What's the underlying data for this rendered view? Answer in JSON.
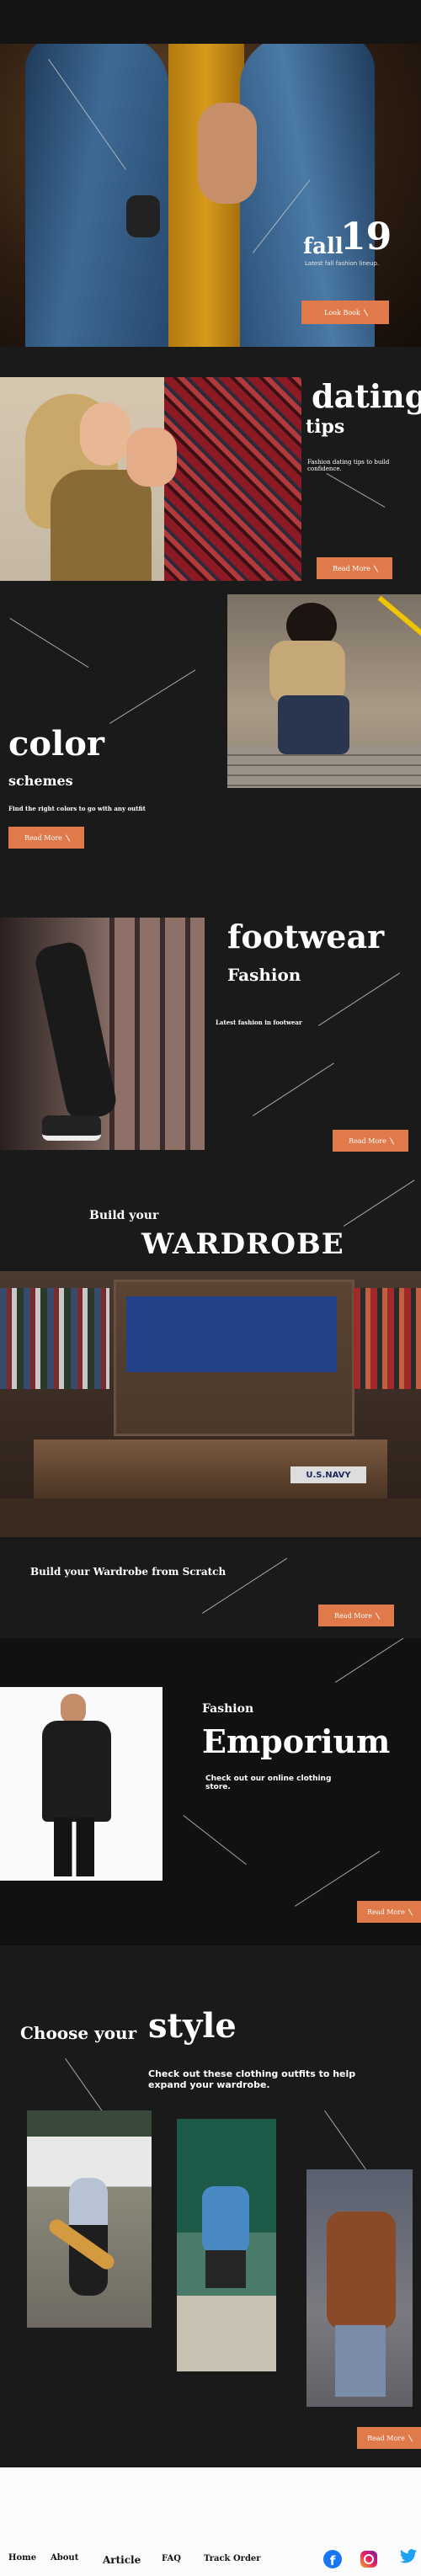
{
  "hero": {
    "title": "fall",
    "number": "19",
    "subtitle": "Latest fall fashion lineup.",
    "button": "Look Book"
  },
  "dating": {
    "title": "dating",
    "subtitle": "tips",
    "desc": "Fashion dating tips to build confidence.",
    "button": "Read More"
  },
  "color": {
    "title": "color",
    "subtitle": "schemes",
    "desc": "Find the right colors to go with any outfit",
    "button": "Read More"
  },
  "footwear": {
    "title": "footwear",
    "subtitle": "Fashion",
    "desc": "Latest fashion in footwear",
    "button": "Read More"
  },
  "wardrobe": {
    "pre": "Build your",
    "title": "WARDROBE",
    "sign": "U.S.NAVY",
    "desc": "Build your Wardrobe from Scratch",
    "button": "Read More"
  },
  "emporium": {
    "pre": "Fashion",
    "title": "Emporium",
    "desc": "Check out  our online clothing store.",
    "button": "Read More"
  },
  "style": {
    "pre": "Choose your",
    "title": "style",
    "desc": "Check out these clothing outfits to help expand your wardrobe.",
    "button": "Read More"
  },
  "footer": {
    "links": [
      "Home",
      "About",
      "Article",
      "FAQ",
      "Track Order"
    ]
  },
  "colors": {
    "accent": "#e07a4a",
    "background": "#1b1a1a"
  }
}
